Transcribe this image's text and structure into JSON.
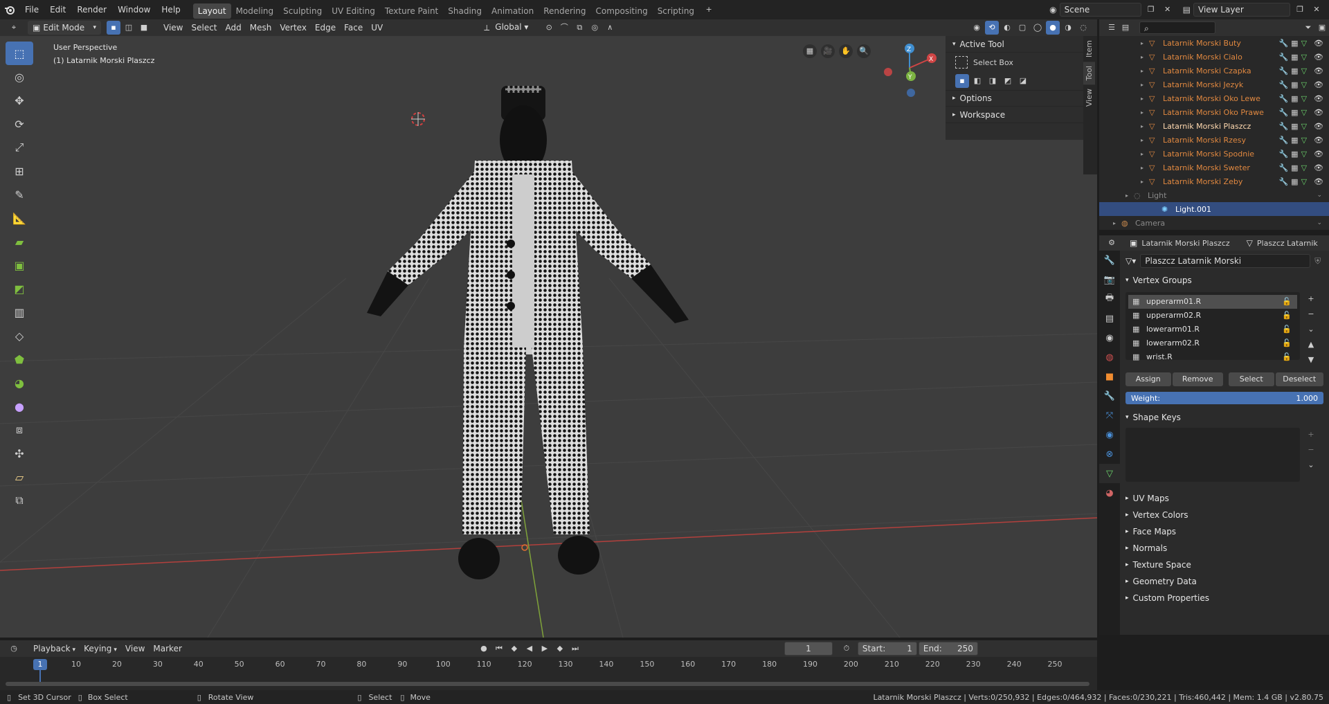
{
  "topbar": {
    "menus": [
      "File",
      "Edit",
      "Render",
      "Window",
      "Help"
    ],
    "workspaces": [
      "Layout",
      "Modeling",
      "Sculpting",
      "UV Editing",
      "Texture Paint",
      "Shading",
      "Animation",
      "Rendering",
      "Compositing",
      "Scripting"
    ],
    "active_workspace": "Layout",
    "scene": "Scene",
    "view_layer": "View Layer"
  },
  "viewport_header": {
    "mode": "Edit Mode",
    "menus": [
      "View",
      "Select",
      "Add",
      "Mesh",
      "Vertex",
      "Edge",
      "Face",
      "UV"
    ],
    "orientation": "Global"
  },
  "viewport": {
    "perspective": "User Perspective",
    "object": "(1) Latarnik Morski Plaszcz",
    "gizmo_axes": [
      "X",
      "Y",
      "Z"
    ]
  },
  "npanel": {
    "active_tool_title": "Active Tool",
    "tool_name": "Select Box",
    "options": "Options",
    "workspace": "Workspace",
    "tabs": [
      "Item",
      "Tool",
      "View"
    ]
  },
  "outliner": {
    "search_placeholder": "",
    "rows": [
      {
        "label": "Latarnik Morski Buty",
        "kind": "mesh"
      },
      {
        "label": "Latarnik Morski Cialo",
        "kind": "mesh"
      },
      {
        "label": "Latarnik Morski Czapka",
        "kind": "mesh"
      },
      {
        "label": "Latarnik Morski Jezyk",
        "kind": "mesh"
      },
      {
        "label": "Latarnik Morski Oko Lewe",
        "kind": "mesh"
      },
      {
        "label": "Latarnik Morski Oko Prawe",
        "kind": "mesh"
      },
      {
        "label": "Latarnik Morski Plaszcz",
        "kind": "active"
      },
      {
        "label": "Latarnik Morski Rzesy",
        "kind": "mesh"
      },
      {
        "label": "Latarnik Morski Spodnie",
        "kind": "mesh"
      },
      {
        "label": "Latarnik Morski Sweter",
        "kind": "mesh"
      },
      {
        "label": "Latarnik Morski Zeby",
        "kind": "mesh"
      },
      {
        "label": "Light",
        "kind": "collection"
      },
      {
        "label": "Light.001",
        "kind": "selected"
      },
      {
        "label": "Camera",
        "kind": "collection"
      }
    ]
  },
  "properties": {
    "breadcrumb_object": "Latarnik Morski Plaszcz",
    "breadcrumb_data": "Plaszcz Latarnik",
    "mesh_name": "Plaszcz Latarnik Morski",
    "vertex_groups_title": "Vertex Groups",
    "vertex_groups": [
      "upperarm01.R",
      "upperarm02.R",
      "lowerarm01.R",
      "lowerarm02.R",
      "wrist.R"
    ],
    "assign": "Assign",
    "remove": "Remove",
    "select": "Select",
    "deselect": "Deselect",
    "weight_label": "Weight:",
    "weight_value": "1.000",
    "shape_keys": "Shape Keys",
    "collapsed_sections": [
      "UV Maps",
      "Vertex Colors",
      "Face Maps",
      "Normals",
      "Texture Space",
      "Geometry Data",
      "Custom Properties"
    ]
  },
  "timeline": {
    "menus": [
      "Playback",
      "Keying",
      "View",
      "Marker"
    ],
    "current_frame": "1",
    "start_label": "Start:",
    "start": "1",
    "end_label": "End:",
    "end": "250",
    "ticks": [
      "10",
      "20",
      "30",
      "40",
      "50",
      "60",
      "70",
      "80",
      "90",
      "100",
      "110",
      "120",
      "130",
      "140",
      "150",
      "160",
      "170",
      "180",
      "190",
      "200",
      "210",
      "220",
      "230",
      "240",
      "250"
    ]
  },
  "statusbar": {
    "hint1": "Set 3D Cursor",
    "hint2": "Box Select",
    "hint3": "Rotate View",
    "hint4": "Select",
    "hint5": "Move",
    "stats": "Latarnik Morski Plaszcz | Verts:0/250,932 | Edges:0/464,932 | Faces:0/230,221 | Tris:460,442 | Mem: 1.4 GB | v2.80.75"
  },
  "colors": {
    "accent": "#4772b3",
    "object_orange": "#e08840",
    "selection_blue": "#334d80"
  }
}
